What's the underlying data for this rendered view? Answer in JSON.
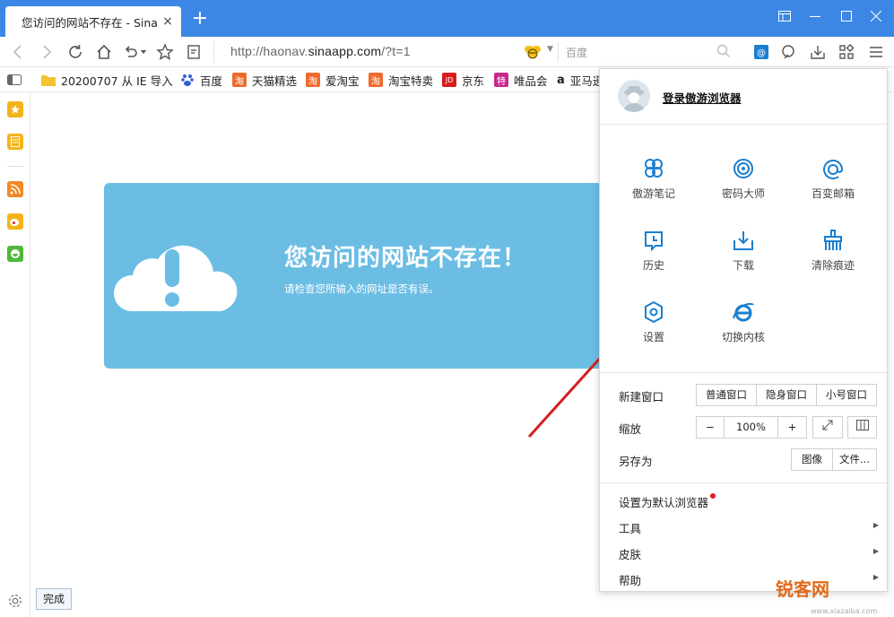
{
  "tab": {
    "title": "您访问的网站不存在 - Sina A",
    "close": "×"
  },
  "new_tab_icon": "plus-icon",
  "nav": {
    "url_prefix": "http://haonav.",
    "url_domain": "sinaapp.com",
    "url_suffix": "/?t=1",
    "search_placeholder": "百度"
  },
  "bookmarks": [
    {
      "label": "20200707 从 IE 导入",
      "icon": "folder-icon",
      "color": "#f4c430"
    },
    {
      "label": "百度",
      "icon": "baidu-icon",
      "color": "#2d5fd4"
    },
    {
      "label": "天猫精选",
      "icon": "tao-icon",
      "color": "#f06a2a"
    },
    {
      "label": "爱淘宝",
      "icon": "tao-icon",
      "color": "#f06a2a"
    },
    {
      "label": "淘宝特卖",
      "icon": "tao-icon",
      "color": "#f06a2a"
    },
    {
      "label": "京东",
      "icon": "jd-icon",
      "color": "#d71c1c"
    },
    {
      "label": "唯品会",
      "icon": "vip-icon",
      "color": "#c8288e"
    },
    {
      "label": "亚马逊",
      "icon": "amazon-icon",
      "color": "#222222"
    }
  ],
  "bookmark_glyphs": {
    "tao": "淘",
    "jd": "JD",
    "vip": "特",
    "amazon": "a"
  },
  "error": {
    "title": "您访问的网站不存在！",
    "subtitle": "请检查您所输入的网址是否有误。",
    "panel_color": "#6bbde4"
  },
  "sidebar": {
    "done_label": "完成"
  },
  "menu": {
    "login": "登录傲游浏览器",
    "grid": [
      {
        "label": "傲游笔记",
        "icon": "notes-icon"
      },
      {
        "label": "密码大师",
        "icon": "fingerprint-icon"
      },
      {
        "label": "百变邮箱",
        "icon": "mail-icon"
      },
      {
        "label": "历史",
        "icon": "history-icon"
      },
      {
        "label": "下载",
        "icon": "download-icon"
      },
      {
        "label": "清除痕迹",
        "icon": "broom-icon"
      },
      {
        "label": "设置",
        "icon": "gear-icon"
      },
      {
        "label": "切换内核",
        "icon": "ie-icon"
      }
    ],
    "new_window": {
      "label": "新建窗口",
      "options": [
        "普通窗口",
        "隐身窗口",
        "小号窗口"
      ]
    },
    "zoom": {
      "label": "缩放",
      "minus": "−",
      "value": "100%",
      "plus": "+"
    },
    "save_as": {
      "label": "另存为",
      "options": [
        "图像",
        "文件..."
      ]
    },
    "items": [
      {
        "label": "设置为默认浏览器"
      },
      {
        "label": "工具"
      },
      {
        "label": "皮肤"
      },
      {
        "label": "帮助"
      }
    ],
    "accent": "#1a7fd0"
  },
  "watermark": {
    "text": "锐客网",
    "url": "www.xiazaiba.com"
  }
}
